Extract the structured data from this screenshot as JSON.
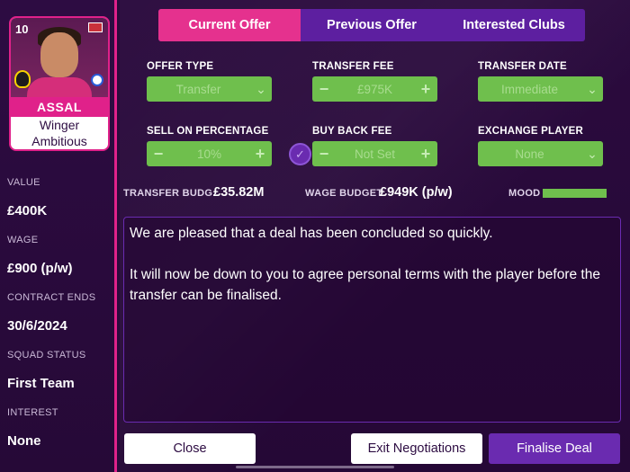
{
  "player": {
    "number": "10",
    "name": "ASSAL",
    "position": "Winger",
    "personality": "Ambitious"
  },
  "sidebar": {
    "stats": [
      {
        "label": "VALUE",
        "value": "£400K"
      },
      {
        "label": "WAGE",
        "value": "£900 (p/w)"
      },
      {
        "label": "CONTRACT ENDS",
        "value": "30/6/2024"
      },
      {
        "label": "SQUAD STATUS",
        "value": "First Team"
      },
      {
        "label": "INTEREST",
        "value": "None"
      }
    ]
  },
  "tabs": [
    {
      "label": "Current Offer",
      "active": true
    },
    {
      "label": "Previous Offer",
      "active": false
    },
    {
      "label": "Interested Clubs",
      "active": false
    }
  ],
  "offer": {
    "offer_type": {
      "label": "OFFER TYPE",
      "value": "Transfer",
      "icon": "chevron-down-icon"
    },
    "transfer_fee": {
      "label": "TRANSFER FEE",
      "value": "£975K"
    },
    "transfer_date": {
      "label": "TRANSFER DATE",
      "value": "Immediate",
      "icon": "chevron-down-icon"
    },
    "sell_on": {
      "label": "SELL ON PERCENTAGE",
      "value": "10%"
    },
    "buy_back": {
      "label": "BUY BACK FEE",
      "value": "Not Set"
    },
    "exchange": {
      "label": "EXCHANGE PLAYER",
      "value": "None",
      "icon": "chevron-down-icon"
    },
    "minus_glyph": "−",
    "plus_glyph": "+",
    "chevron_glyph": "⌄",
    "check_glyph": "✓"
  },
  "budgets": {
    "transfer_label": "TRANSFER BUDG..",
    "transfer_value": "£35.82M",
    "wage_label": "WAGE BUDGET",
    "wage_value": "£949K (p/w)",
    "mood_label": "MOOD",
    "mood_level": 1.0
  },
  "message": {
    "line1": "We are pleased that a deal has been concluded so quickly.",
    "line2": "It will now be down to you to agree personal terms with the player before the transfer can be finalised."
  },
  "buttons": {
    "close": "Close",
    "exit": "Exit Negotiations",
    "finalise": "Finalise Deal"
  },
  "colors": {
    "accent_pink": "#e5318e",
    "accent_purple": "#6a2bb0",
    "field_green": "#6fbf4d",
    "background": "#2a0a3c"
  }
}
